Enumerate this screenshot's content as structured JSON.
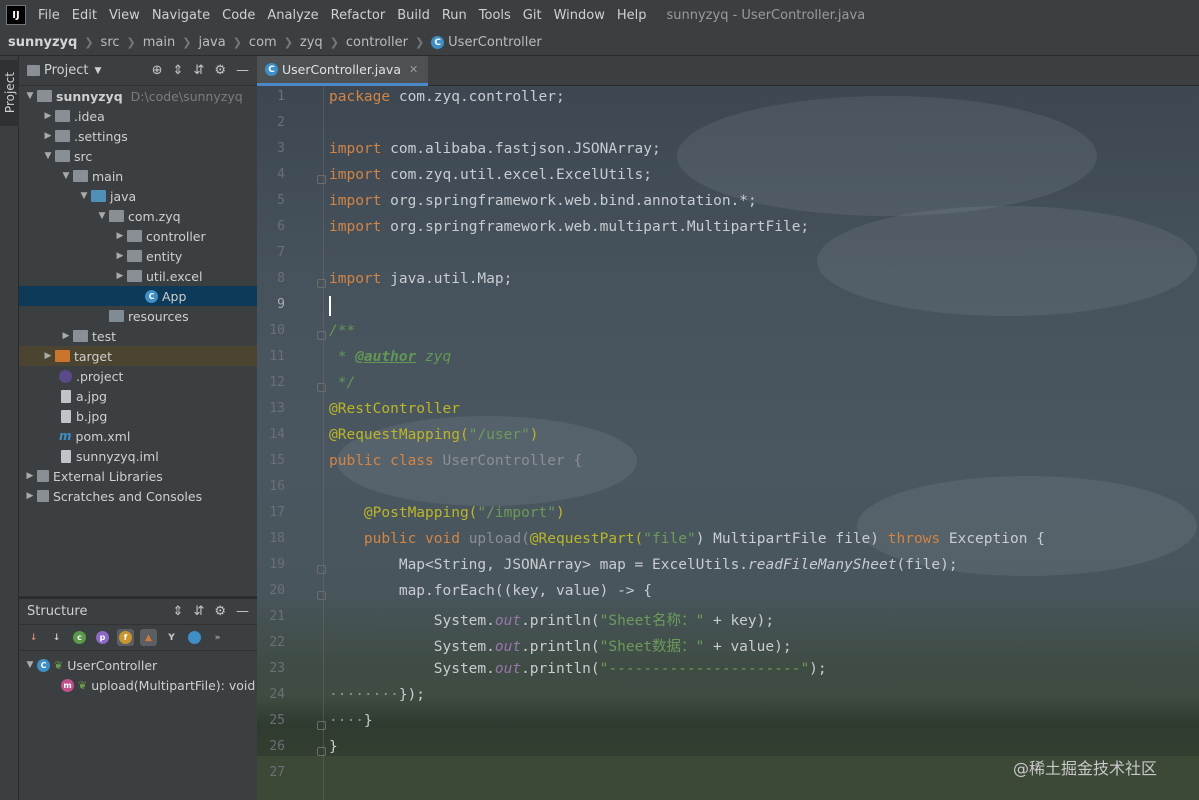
{
  "menubar": {
    "logo": "IJ",
    "items": [
      "File",
      "Edit",
      "View",
      "Navigate",
      "Code",
      "Analyze",
      "Refactor",
      "Build",
      "Run",
      "Tools",
      "Git",
      "Window",
      "Help"
    ],
    "window_title": "sunnyzyq - UserController.java"
  },
  "breadcrumb": {
    "items": [
      "sunnyzyq",
      "src",
      "main",
      "java",
      "com",
      "zyq",
      "controller",
      "UserController"
    ]
  },
  "stripe": {
    "project_tab": "Project"
  },
  "project": {
    "title": "Project",
    "tree": [
      {
        "label": "sunnyzyq",
        "extra": "D:\\code\\sunnyzyq"
      },
      {
        "label": ".idea"
      },
      {
        "label": ".settings"
      },
      {
        "label": "src"
      },
      {
        "label": "main"
      },
      {
        "label": "java"
      },
      {
        "label": "com.zyq"
      },
      {
        "label": "controller"
      },
      {
        "label": "entity"
      },
      {
        "label": "util.excel"
      },
      {
        "label": "App"
      },
      {
        "label": "resources"
      },
      {
        "label": "test"
      },
      {
        "label": "target"
      },
      {
        "label": ".project"
      },
      {
        "label": "a.jpg"
      },
      {
        "label": "b.jpg"
      },
      {
        "label": "pom.xml"
      },
      {
        "label": "sunnyzyq.iml"
      },
      {
        "label": "External Libraries"
      },
      {
        "label": "Scratches and Consoles"
      }
    ]
  },
  "structure": {
    "title": "Structure",
    "class_name": "UserController",
    "method": "upload(MultipartFile): void"
  },
  "editor": {
    "tab_label": "UserController.java",
    "line_numbers": [
      "1",
      "2",
      "3",
      "4",
      "5",
      "6",
      "7",
      "8",
      "9",
      "10",
      "11",
      "12",
      "13",
      "14",
      "15",
      "16",
      "17",
      "18",
      "19",
      "20",
      "21",
      "22",
      "23",
      "24",
      "25",
      "26",
      "27"
    ],
    "code": {
      "l1": [
        "package",
        " com.zyq.controller;"
      ],
      "l3": [
        "import",
        " com.alibaba.fastjson.JSONArray;"
      ],
      "l4": [
        "import",
        " com.zyq.util.excel.ExcelUtils;"
      ],
      "l5": [
        "import",
        " org.springframework.web.bind.annotation.*;"
      ],
      "l6": [
        "import",
        " org.springframework.web.multipart.MultipartFile;"
      ],
      "l8": [
        "import",
        " java.util.Map;"
      ],
      "l10": "/**",
      "l11": [
        " * ",
        "@author",
        " zyq"
      ],
      "l12": " */",
      "l13": "@RestController",
      "l14": [
        "@RequestMapping(",
        "\"/user\"",
        ")"
      ],
      "l15": [
        "public class ",
        "UserController {"
      ],
      "l17": [
        "    ",
        "@PostMapping(",
        "\"/import\"",
        ")"
      ],
      "l18": [
        "    ",
        "public void ",
        "upload(",
        "@RequestPart(",
        "\"file\"",
        ") MultipartFile file) ",
        "throws ",
        "Exception {"
      ],
      "l19": [
        "        Map<String, JSONArray> map = ExcelUtils.",
        "readFileManySheet",
        "(file);"
      ],
      "l20": [
        "        map.forEach((key, value) -> {"
      ],
      "l21": [
        "            System.",
        "out",
        ".println(",
        "\"Sheet名称：\"",
        " + key);"
      ],
      "l22": [
        "            System.",
        "out",
        ".println(",
        "\"Sheet数据：\"",
        " + value);"
      ],
      "l23": [
        "            System.",
        "out",
        ".println(",
        "\"----------------------\"",
        ");"
      ],
      "l24": [
        "········",
        "});"
      ],
      "l25": [
        "····",
        "}"
      ],
      "l26": "}"
    }
  },
  "watermark": "@稀土掘金技术社区",
  "colors": {
    "keyword": "#d28445",
    "annotation": "#bbb529",
    "string": "#6d9b59",
    "comment": "#629755",
    "selection": "#0d3a58",
    "tab_accent": "#4a88c7"
  }
}
